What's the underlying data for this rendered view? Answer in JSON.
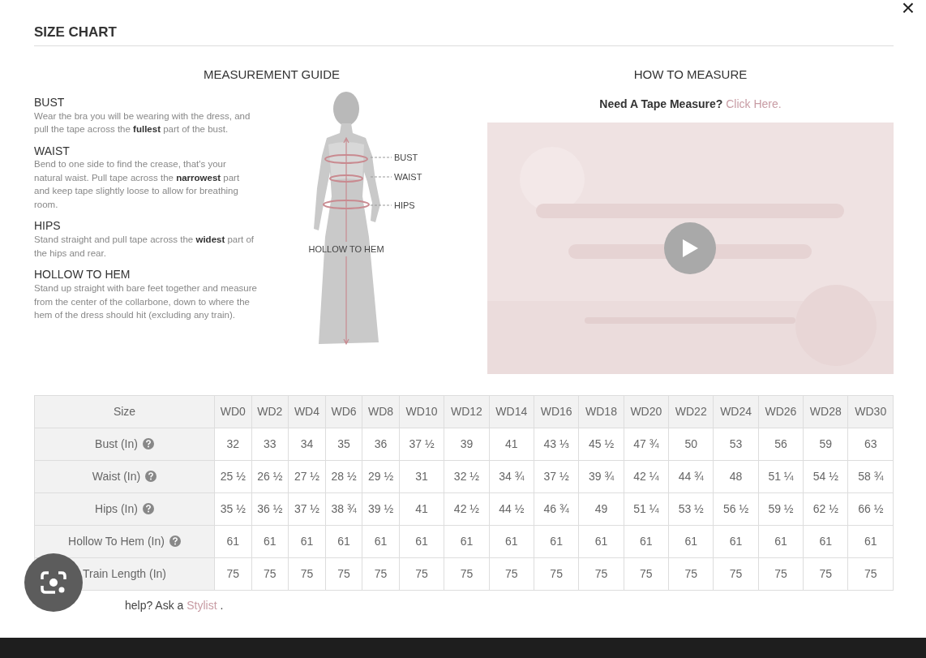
{
  "close": "×",
  "title": "SIZE CHART",
  "guide": {
    "heading": "MEASUREMENT GUIDE",
    "sections": [
      {
        "title": "BUST",
        "text": "Wear the bra you will be wearing with the dress, and pull the tape across the **fullest** part of the bust."
      },
      {
        "title": "WAIST",
        "text": "Bend to one side to find the crease, that's your natural waist. Pull tape across the **narrowest** part and keep tape slightly loose to allow for breathing room."
      },
      {
        "title": "HIPS",
        "text": "Stand straight and pull tape across the **widest** part of the hips and rear."
      },
      {
        "title": "HOLLOW TO HEM",
        "text": "Stand up straight with bare feet together and measure from the center of the collarbone, down to where the hem of the dress should hit (excluding any train)."
      }
    ],
    "figure_labels": [
      "BUST",
      "WAIST",
      "HIPS",
      "HOLLOW TO HEM"
    ]
  },
  "how_to": {
    "heading": "HOW TO MEASURE",
    "prompt": "Need A Tape Measure?",
    "link": "Click Here."
  },
  "table": {
    "row_header": "Size",
    "columns": [
      "WD0",
      "WD2",
      "WD4",
      "WD6",
      "WD8",
      "WD10",
      "WD12",
      "WD14",
      "WD16",
      "WD18",
      "WD20",
      "WD22",
      "WD24",
      "WD26",
      "WD28",
      "WD30"
    ],
    "rows": [
      {
        "label": "Bust (In)",
        "help": true,
        "cells": [
          "32",
          "33",
          "34",
          "35",
          "36",
          "37 ½",
          "39",
          "41",
          "43 ⅓",
          "45 ½",
          "47 ¾",
          "50",
          "53",
          "56",
          "59",
          "63"
        ]
      },
      {
        "label": "Waist (In)",
        "help": true,
        "cells": [
          "25 ½",
          "26 ½",
          "27 ½",
          "28 ½",
          "29 ½",
          "31",
          "32 ½",
          "34 ¾",
          "37 ½",
          "39 ¾",
          "42 ¼",
          "44 ¾",
          "48",
          "51 ¼",
          "54 ½",
          "58 ¾"
        ]
      },
      {
        "label": "Hips (In)",
        "help": true,
        "cells": [
          "35 ½",
          "36 ½",
          "37 ½",
          "38 ¾",
          "39 ½",
          "41",
          "42 ½",
          "44 ½",
          "46 ¾",
          "49",
          "51 ¼",
          "53 ½",
          "56 ½",
          "59 ½",
          "62 ½",
          "66 ½"
        ]
      },
      {
        "label": "Hollow To Hem (In)",
        "help": true,
        "cells": [
          "61",
          "61",
          "61",
          "61",
          "61",
          "61",
          "61",
          "61",
          "61",
          "61",
          "61",
          "61",
          "61",
          "61",
          "61",
          "61"
        ]
      },
      {
        "label": "Train Length (In)",
        "help": false,
        "cells": [
          "75",
          "75",
          "75",
          "75",
          "75",
          "75",
          "75",
          "75",
          "75",
          "75",
          "75",
          "75",
          "75",
          "75",
          "75",
          "75"
        ]
      }
    ]
  },
  "footer": {
    "text": "help? Ask a",
    "link": "Stylist",
    "end": "."
  }
}
